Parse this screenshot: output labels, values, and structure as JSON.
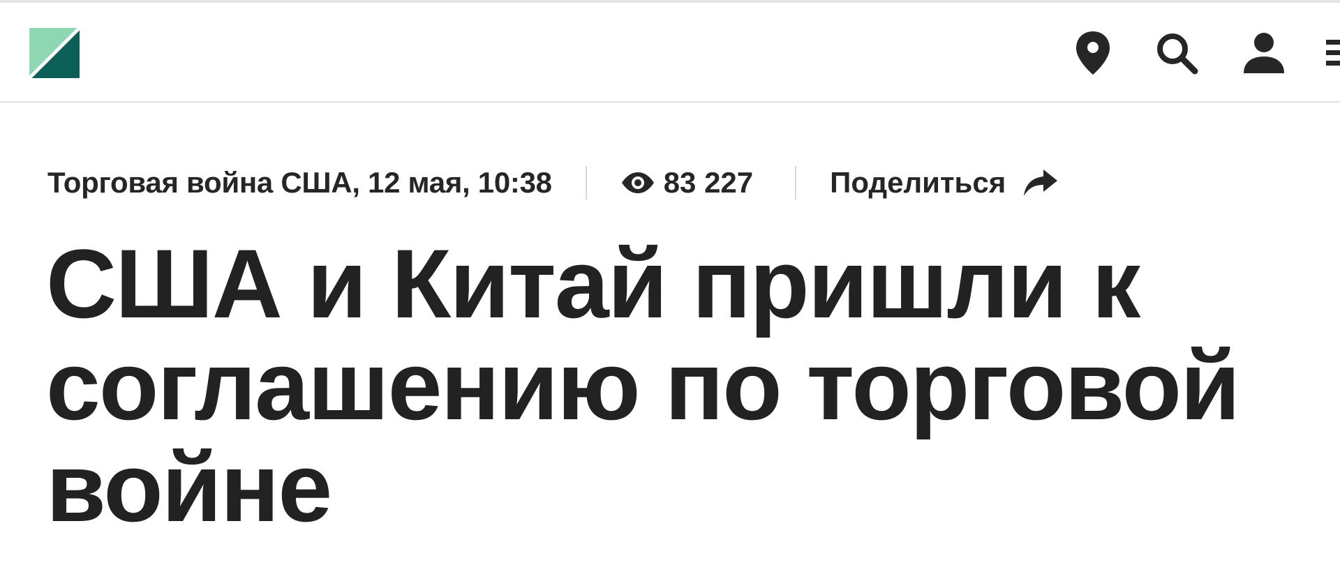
{
  "header": {
    "logo": {
      "icon": "brand-logo-icon",
      "colors": [
        "#8fd6b3",
        "#0c5f56"
      ]
    },
    "actions": [
      {
        "icon": "location-pin-icon"
      },
      {
        "icon": "search-icon"
      },
      {
        "icon": "user-icon"
      },
      {
        "icon": "menu-icon"
      }
    ]
  },
  "article": {
    "rubric_date": "Торговая война США, 12 мая, 10:38",
    "views": "83 227",
    "share_label": "Поделиться",
    "headline": "США и Китай пришли к соглашению по торговой войне"
  },
  "colors": {
    "text": "#222222",
    "divider": "#d8d8d8",
    "logo_light": "#8fd6b3",
    "logo_dark": "#0c5f56"
  }
}
